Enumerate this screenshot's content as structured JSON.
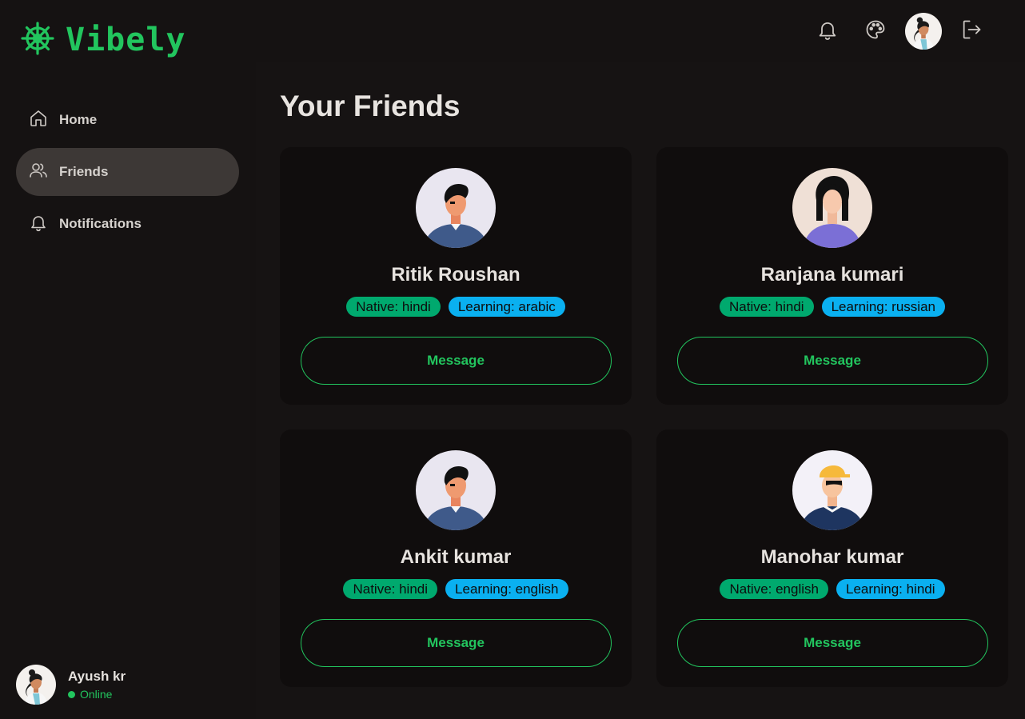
{
  "brand": {
    "name": "Vibely",
    "color": "#22c55e"
  },
  "nav": [
    {
      "label": "Home",
      "icon": "home-icon",
      "active": false
    },
    {
      "label": "Friends",
      "icon": "users-icon",
      "active": true
    },
    {
      "label": "Notifications",
      "icon": "bell-icon",
      "active": false
    }
  ],
  "user": {
    "name": "Ayush kr",
    "status": "Online"
  },
  "topbar": {
    "icons": [
      "bell-icon",
      "palette-icon",
      "avatar",
      "logout-icon"
    ]
  },
  "page": {
    "title": "Your Friends"
  },
  "friends": [
    {
      "name": "Ritik Roushan",
      "native": "Native: hindi",
      "learning": "Learning: arabic",
      "button": "Message"
    },
    {
      "name": "Ranjana kumari",
      "native": "Native: hindi",
      "learning": "Learning: russian",
      "button": "Message"
    },
    {
      "name": "Ankit kumar",
      "native": "Native: hindi",
      "learning": "Learning: english",
      "button": "Message"
    },
    {
      "name": "Manohar kumar",
      "native": "Native: english",
      "learning": "Learning: hindi",
      "button": "Message"
    }
  ],
  "colors": {
    "accent": "#22c55e",
    "native_tag": "#00a96e",
    "learning_tag": "#0ab0f0",
    "active_nav": "#3d3836"
  }
}
